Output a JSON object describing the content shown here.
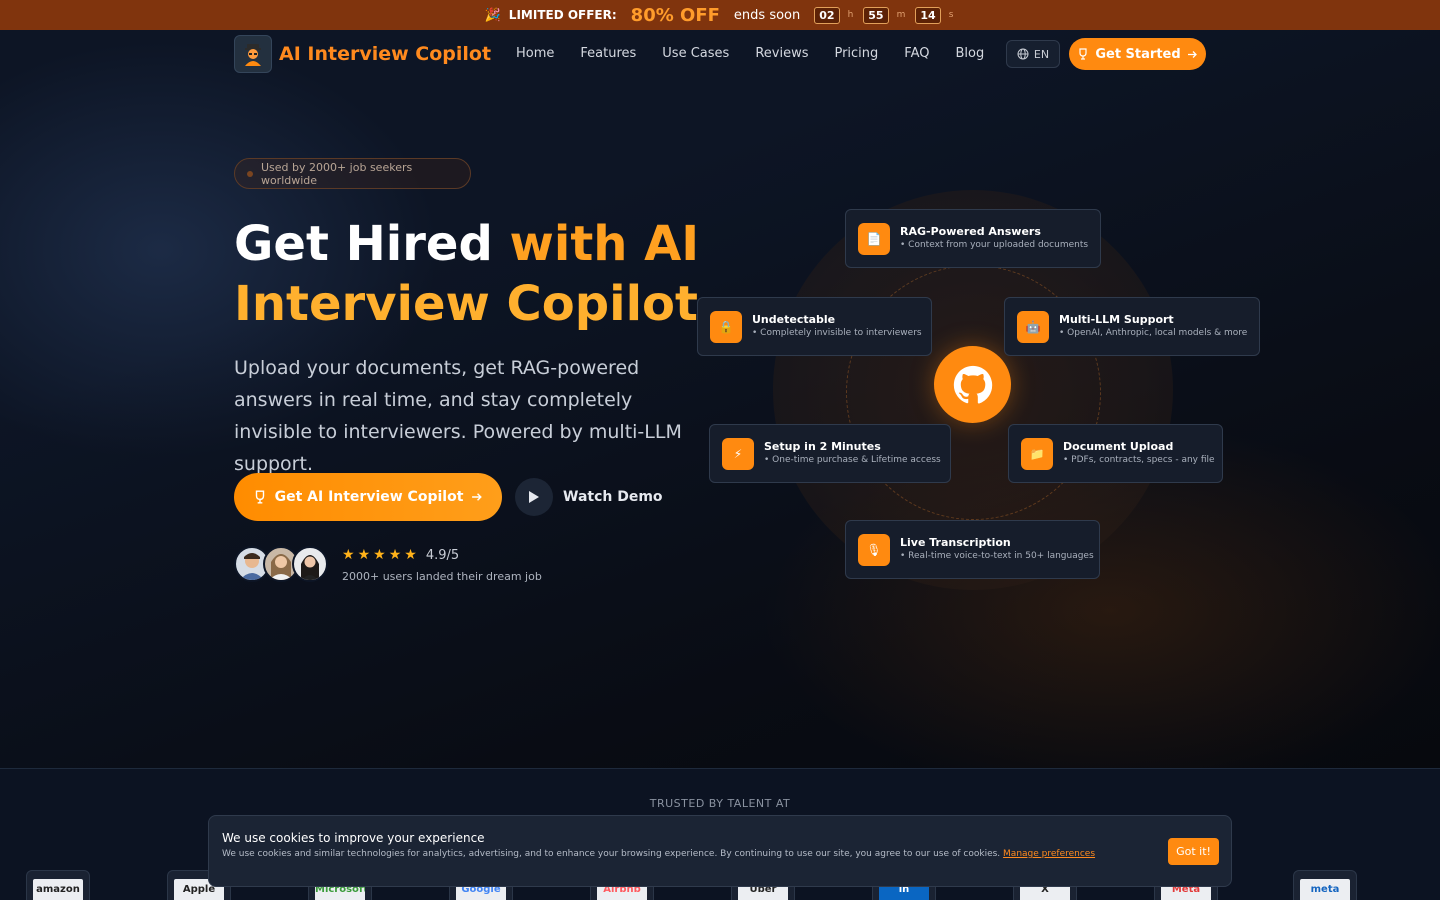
{
  "promo": {
    "emoji": "🎉",
    "label": "LIMITED OFFER:",
    "discount": "80% OFF",
    "ends": "ends soon",
    "hours": "02",
    "hours_unit": "h",
    "minutes": "55",
    "minutes_unit": "m",
    "seconds": "14",
    "seconds_unit": "s"
  },
  "nav": {
    "brand": "AI Interview Copilot",
    "links": [
      "Home",
      "Features",
      "Use Cases",
      "Reviews",
      "Pricing",
      "FAQ",
      "Blog"
    ],
    "language": "EN",
    "cta": "Get Started"
  },
  "hero": {
    "badge": "Used by 2000+ job seekers worldwide",
    "title_part1": "Get Hired ",
    "title_part2": "with AI",
    "title_part3": "Interview Copilot",
    "subtitle": "Upload your documents, get RAG-powered answers in real time, and stay completely invisible to interviewers. Powered by multi-LLM support.",
    "cta": "Get AI Interview Copilot",
    "demo": "Watch Demo",
    "rating_stars": 5,
    "rating_score": "4.9/5",
    "rating_caption": "2000+ users landed their dream job"
  },
  "features": [
    {
      "title": "RAG-Powered Answers",
      "desc": "• Context from your uploaded documents",
      "icon": "📄"
    },
    {
      "title": "Undetectable",
      "desc": "• Completely invisible to interviewers",
      "icon": "🔒"
    },
    {
      "title": "Multi-LLM Support",
      "desc": "• OpenAI, Anthropic, local models & more",
      "icon": "🤖"
    },
    {
      "title": "Setup in 2 Minutes",
      "desc": "• One-time purchase & Lifetime access",
      "icon": "⚡"
    },
    {
      "title": "Document Upload",
      "desc": "• PDFs, contracts, specs - any file",
      "icon": "📁"
    },
    {
      "title": "Live Transcription",
      "desc": "• Real-time voice-to-text in 50+ languages",
      "icon": "🎙"
    }
  ],
  "trusted": {
    "title": "TRUSTED BY TALENT AT",
    "logos": [
      "amazon",
      "Apple",
      "Microsoft",
      "Google",
      "Airbnb",
      "Uber",
      "in",
      "X",
      "Meta",
      "meta"
    ]
  },
  "cookie": {
    "title": "We use cookies to improve your experience",
    "text": "We use cookies and similar technologies for analytics, advertising, and to enhance your browsing experience. By continuing to use our site, you agree to our use of cookies.",
    "link": "Manage preferences",
    "button": "Got it!"
  },
  "colors": {
    "accent": "#ff8a10",
    "promo_bg": "#80340d",
    "page_bg": "#0d1525"
  }
}
